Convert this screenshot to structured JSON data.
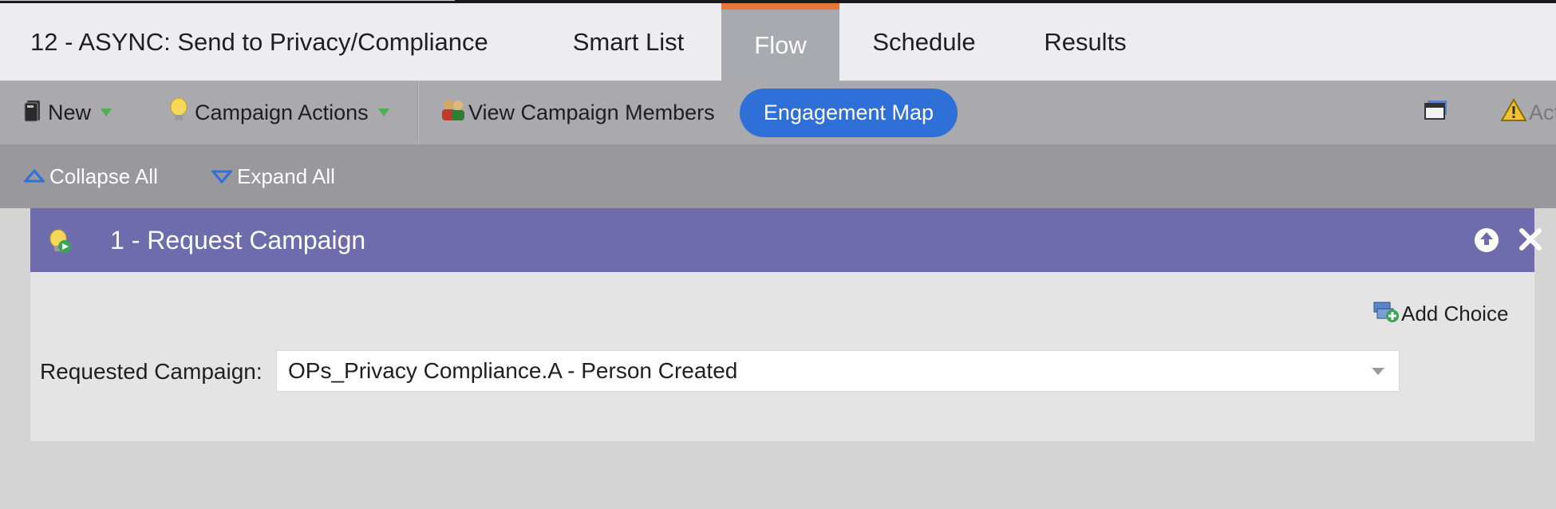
{
  "tabs": {
    "title": "12 - ASYNC: Send to Privacy/Compliance",
    "smart_list": "Smart List",
    "flow": "Flow",
    "schedule": "Schedule",
    "results": "Results"
  },
  "toolbar": {
    "new_label": "New",
    "campaign_actions_label": "Campaign Actions",
    "view_members_label": "View Campaign Members",
    "engagement_map_label": "Engagement Map",
    "activate_label": "Act"
  },
  "subtoolbar": {
    "collapse_label": "Collapse All",
    "expand_label": "Expand All"
  },
  "flow_step": {
    "title": "1 - Request Campaign",
    "add_choice_label": "Add Choice",
    "field_label": "Requested Campaign:",
    "field_value": "OPs_Privacy Compliance.A - Person Created"
  },
  "colors": {
    "active_tab_accent": "#e8753a",
    "engagement_button": "#2f6fd8",
    "panel_header": "#6e6cad"
  }
}
